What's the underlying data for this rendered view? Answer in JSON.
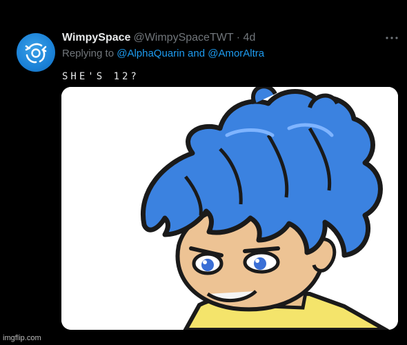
{
  "tweet": {
    "display_name": "WimpySpace",
    "handle": "@WimpySpaceTWT",
    "separator": "·",
    "timestamp": "4d",
    "reply_prefix": "Replying to",
    "reply_mentions": [
      "@AlphaQuarin",
      "@AmorAltra"
    ],
    "reply_conjunction": "and",
    "text": "SHE'S 12?",
    "avatar_icon": "stylized-logo-icon",
    "more_icon": "more-options-icon"
  },
  "watermark": "imgflip.com",
  "colors": {
    "background": "#000000",
    "name": "#e7e9ea",
    "muted": "#71767b",
    "link": "#1d9bf0",
    "avatar": "#1b82d8"
  }
}
